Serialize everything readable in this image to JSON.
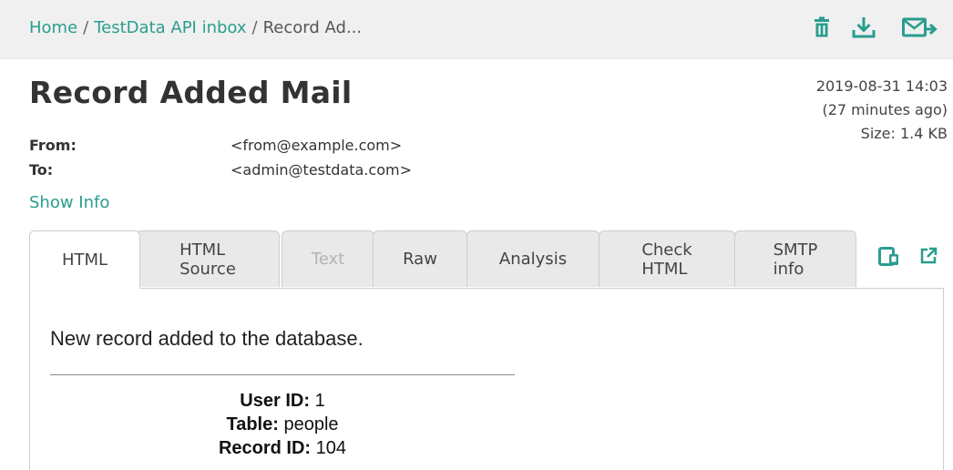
{
  "breadcrumb": {
    "home": "Home",
    "separator": "/",
    "inbox": "TestData API inbox",
    "current": "Record Ad..."
  },
  "toolbar": {
    "icons": [
      "trash-icon",
      "download-icon",
      "forward-mail-icon"
    ],
    "accent_color": "#2a9d8f"
  },
  "message": {
    "subject": "Record Added Mail",
    "date": "2019-08-31 14:03",
    "relative_time": "(27 minutes ago)",
    "size": "Size: 1.4 KB",
    "from_label": "From:",
    "from_value": "<from@example.com>",
    "to_label": "To:",
    "to_value": "<admin@testdata.com>",
    "show_info": "Show Info"
  },
  "tabs": [
    {
      "line1": "HTML",
      "line2": "",
      "state": "active"
    },
    {
      "line1": "HTML",
      "line2": "Source",
      "state": "normal"
    },
    {
      "line1": "Text",
      "line2": "",
      "state": "disabled"
    },
    {
      "line1": "Raw",
      "line2": "",
      "state": "normal"
    },
    {
      "line1": "Analysis",
      "line2": "",
      "state": "normal"
    },
    {
      "line1": "Check",
      "line2": "HTML",
      "state": "normal"
    },
    {
      "line1": "SMTP",
      "line2": "info",
      "state": "normal"
    }
  ],
  "tab_icons": [
    "devices-icon",
    "open-external-icon"
  ],
  "body": {
    "intro": "New record added to the database.",
    "user_id_label": "User ID:",
    "user_id_value": "1",
    "table_label": "Table:",
    "table_value": "people",
    "record_id_label": "Record ID:",
    "record_id_value": "104"
  }
}
